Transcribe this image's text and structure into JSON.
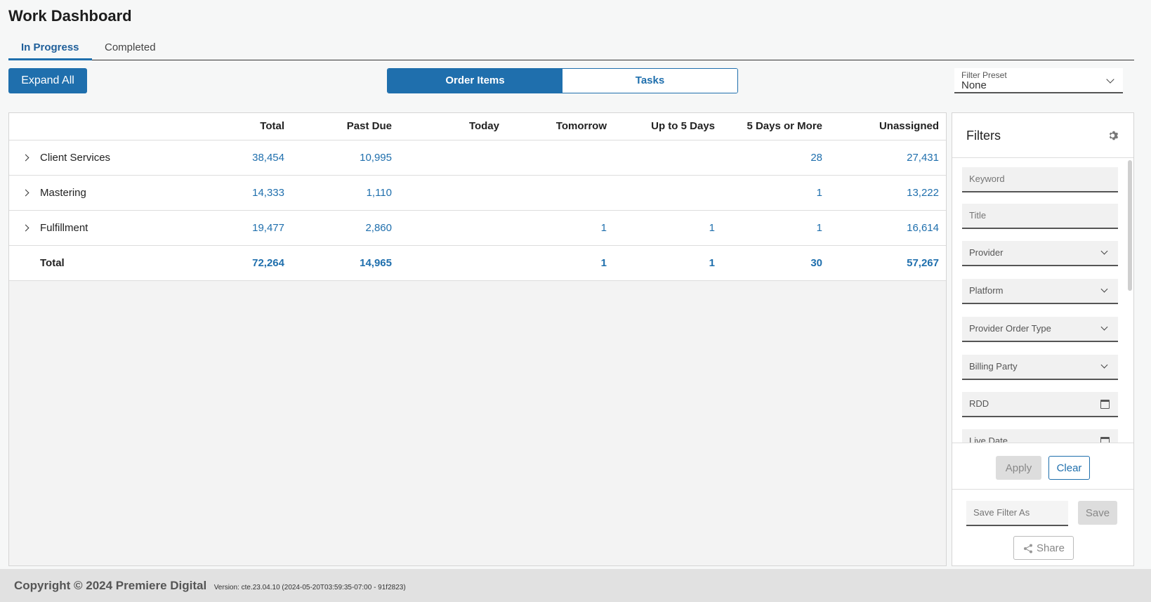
{
  "page": {
    "title": "Work Dashboard"
  },
  "tabs": [
    {
      "label": "In Progress"
    },
    {
      "label": "Completed"
    }
  ],
  "toolbar": {
    "expand_all": "Expand All",
    "segments": [
      "Order Items",
      "Tasks"
    ],
    "filter_preset": {
      "label": "Filter Preset",
      "value": "None"
    }
  },
  "table": {
    "columns": [
      "",
      "Total",
      "Past Due",
      "Today",
      "Tomorrow",
      "Up to 5 Days",
      "5 Days or More",
      "Unassigned"
    ],
    "rows": [
      {
        "name": "Client Services",
        "values": [
          "38,454",
          "10,995",
          "",
          "",
          "",
          "28",
          "27,431"
        ]
      },
      {
        "name": "Mastering",
        "values": [
          "14,333",
          "1,110",
          "",
          "",
          "",
          "1",
          "13,222"
        ]
      },
      {
        "name": "Fulfillment",
        "values": [
          "19,477",
          "2,860",
          "",
          "1",
          "1",
          "1",
          "16,614"
        ]
      }
    ],
    "total": {
      "name": "Total",
      "values": [
        "72,264",
        "14,965",
        "",
        "1",
        "1",
        "30",
        "57,267"
      ]
    }
  },
  "filters": {
    "title": "Filters",
    "fields": [
      {
        "label": "Keyword",
        "type": "text"
      },
      {
        "label": "Title",
        "type": "text"
      },
      {
        "label": "Provider",
        "type": "select"
      },
      {
        "label": "Platform",
        "type": "select"
      },
      {
        "label": "Provider Order Type",
        "type": "select"
      },
      {
        "label": "Billing Party",
        "type": "select"
      },
      {
        "label": "RDD",
        "type": "date"
      },
      {
        "label": "Live Date",
        "type": "date"
      }
    ],
    "apply": "Apply",
    "clear": "Clear",
    "save_placeholder": "Save Filter As",
    "save": "Save",
    "share": "Share"
  },
  "footer": {
    "copyright": "Copyright © 2024 Premiere Digital",
    "version": "Version: cte.23.04.10 (2024-05-20T03:59:35-07:00 - 91f2823)"
  },
  "colors": {
    "accent": "#1f6fad",
    "footer_bg": "#e1e1e1"
  },
  "icons": [
    "chevron-right-icon",
    "chevron-down-icon",
    "gear-icon",
    "calendar-icon",
    "share-icon"
  ]
}
